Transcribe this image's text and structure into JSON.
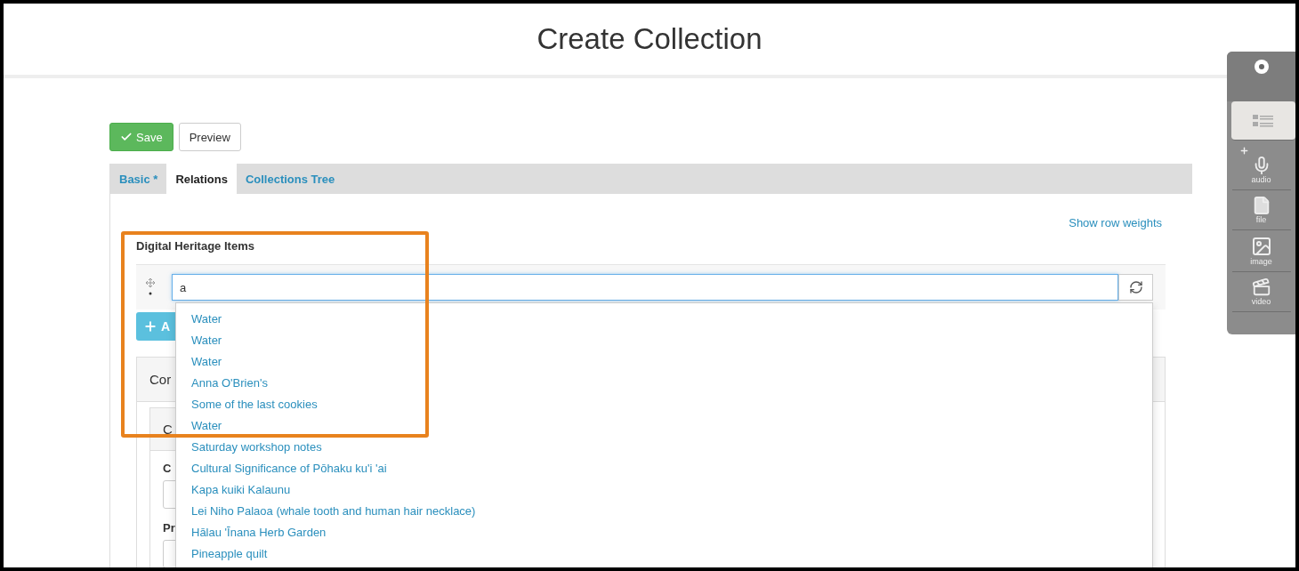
{
  "header": {
    "title": "Create Collection"
  },
  "actions": [
    {
      "kind": "save",
      "label": "Save"
    },
    {
      "kind": "preview",
      "label": "Preview"
    }
  ],
  "tabs": [
    {
      "label": "Basic *",
      "selected": false
    },
    {
      "label": "Relations",
      "selected": true
    },
    {
      "label": "Collections Tree",
      "selected": false
    }
  ],
  "show_row_weights": "Show row weights",
  "field": {
    "label": "Digital Heritage Items",
    "value": "a",
    "suggestions": [
      "Water",
      "Water",
      "Water",
      "Anna O'Brien's",
      "Some of the last cookies",
      "Water",
      "Saturday workshop notes",
      "Cultural Significance of Pōhaku ku'i 'ai",
      "Kapa kuiki Kalaunu",
      "Lei Niho Palaoa (whale tooth and human hair necklace)",
      "Hālau 'Īnana Herb Garden",
      "Pineapple quilt"
    ]
  },
  "add_button": {
    "label": "A"
  },
  "collection_panel": {
    "title": "Cor",
    "inner_title": "C",
    "fields": [
      {
        "label": "C"
      },
      {
        "label": "Pr"
      }
    ]
  },
  "side_toolbar": {
    "items": [
      {
        "kind": "list",
        "selected": true
      },
      {
        "kind": "audio",
        "label": "audio",
        "selected": false
      },
      {
        "kind": "file",
        "label": "file",
        "selected": false
      },
      {
        "kind": "image",
        "label": "image",
        "selected": false
      },
      {
        "kind": "video",
        "label": "video",
        "selected": false
      }
    ]
  }
}
